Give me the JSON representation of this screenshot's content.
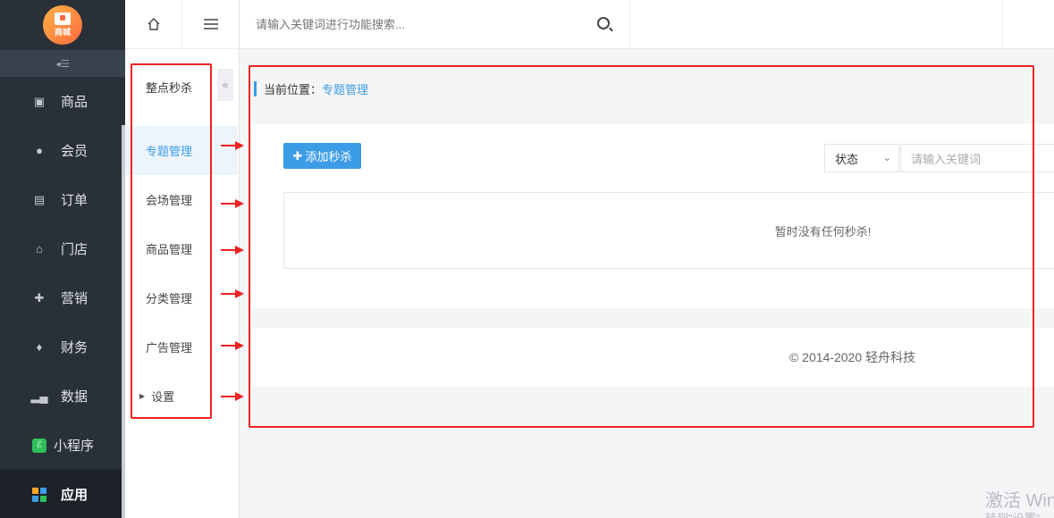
{
  "app": {
    "logo_text": "商城"
  },
  "sidebar": {
    "items": [
      {
        "label": "商品",
        "icon": "bag-icon"
      },
      {
        "label": "会员",
        "icon": "user-icon"
      },
      {
        "label": "订单",
        "icon": "document-icon"
      },
      {
        "label": "门店",
        "icon": "store-icon"
      },
      {
        "label": "营销",
        "icon": "gift-icon"
      },
      {
        "label": "财务",
        "icon": "money-bag-icon"
      },
      {
        "label": "数据",
        "icon": "bar-chart-icon"
      },
      {
        "label": "小程序",
        "icon": "mini-program-icon"
      },
      {
        "label": "应用",
        "icon": "apps-grid-icon",
        "active": true
      }
    ]
  },
  "subnav": {
    "title": "整点秒杀",
    "items": [
      {
        "label": "专题管理",
        "active": true
      },
      {
        "label": "会场管理"
      },
      {
        "label": "商品管理"
      },
      {
        "label": "分类管理"
      },
      {
        "label": "广告管理"
      },
      {
        "label": "设置",
        "expandable": true
      }
    ]
  },
  "topbar": {
    "search_placeholder": "请输入关键词进行功能搜索..."
  },
  "breadcrumb": {
    "prefix": "当前位置：",
    "current": "专题管理"
  },
  "toolbar": {
    "add_label": "添加秒杀",
    "status_label": "状态",
    "keyword_placeholder": "请输入关键词"
  },
  "empty_text": "暂时没有任何秒杀!",
  "footer": {
    "copyright": "© 2014-2020 轻舟科技"
  },
  "watermark": {
    "line1": "激活 Win",
    "line2": "转到\"设置\""
  },
  "colors": {
    "accent": "#3d9ce6",
    "sidebar_bg": "#293038",
    "annotation_red": "#ee2222"
  }
}
